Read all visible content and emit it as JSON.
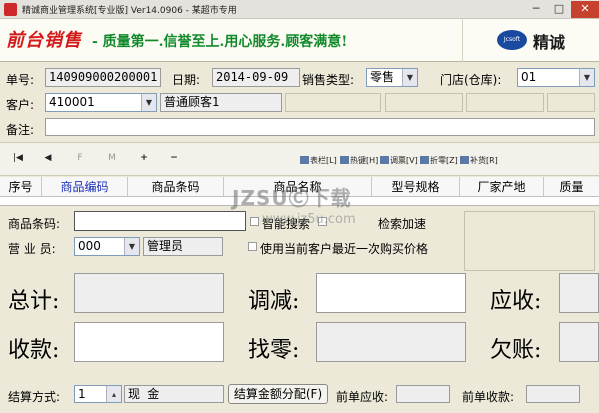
{
  "window": {
    "title": "精诚商业管理系统[专业版] Ver14.0906 - 某超市专用",
    "minimize": "─",
    "maximize": "□",
    "close": "✕"
  },
  "banner": {
    "title": "前台销售",
    "slogan": "- 质量第一.信誉至上.用心服务.顾客满意!",
    "logo_badge": "Jcsoft",
    "logo_text": "精诚"
  },
  "form": {
    "doc_no_label": "单号:",
    "doc_no": "140909000200001",
    "date_label": "日期:",
    "date": "2014-09-09",
    "sale_type_label": "销售类型:",
    "sale_type": "零售",
    "store_label": "门店(仓库):",
    "store": "01",
    "customer_label": "客户:",
    "customer_code": "410001",
    "customer_name": "普通顾客1",
    "remark_label": "备注:",
    "remark": ""
  },
  "toolbar": {
    "first": "|◀",
    "prev": "◀",
    "mark1": "F",
    "mark2": "M",
    "add": "+",
    "remove": "−",
    "buttons": [
      "表栏[L]",
      "热键[H]",
      "调票[V]",
      "折零[Z]",
      "补货[R]"
    ]
  },
  "grid": {
    "columns": [
      "序号",
      "商品编码",
      "商品条码",
      "商品名称",
      "型号规格",
      "厂家产地",
      "质量"
    ]
  },
  "entry": {
    "barcode_label": "商品条码:",
    "barcode": "",
    "smart_search_label": "智能搜索",
    "search_speedup_label": "检索加速",
    "clerk_label": "营 业 员:",
    "clerk_code": "000",
    "clerk_name": "管理员",
    "last_price_label": "使用当前客户最近一次购买价格"
  },
  "totals": {
    "total_label": "总计:",
    "adjust_label": "调减:",
    "receivable_label": "应收:",
    "received_label": "收款:",
    "change_label": "找零:",
    "owed_label": "欠账:"
  },
  "footer": {
    "settle_label": "结算方式:",
    "settle_code": "1",
    "settle_name": "现   金",
    "allocate_button": "结算金额分配(F)",
    "prev_receivable_label": "前单应收:",
    "prev_received_label": "前单收款:"
  },
  "watermark": {
    "main": "JZSUⒸ下载",
    "sub": "www.jz5u.com"
  }
}
